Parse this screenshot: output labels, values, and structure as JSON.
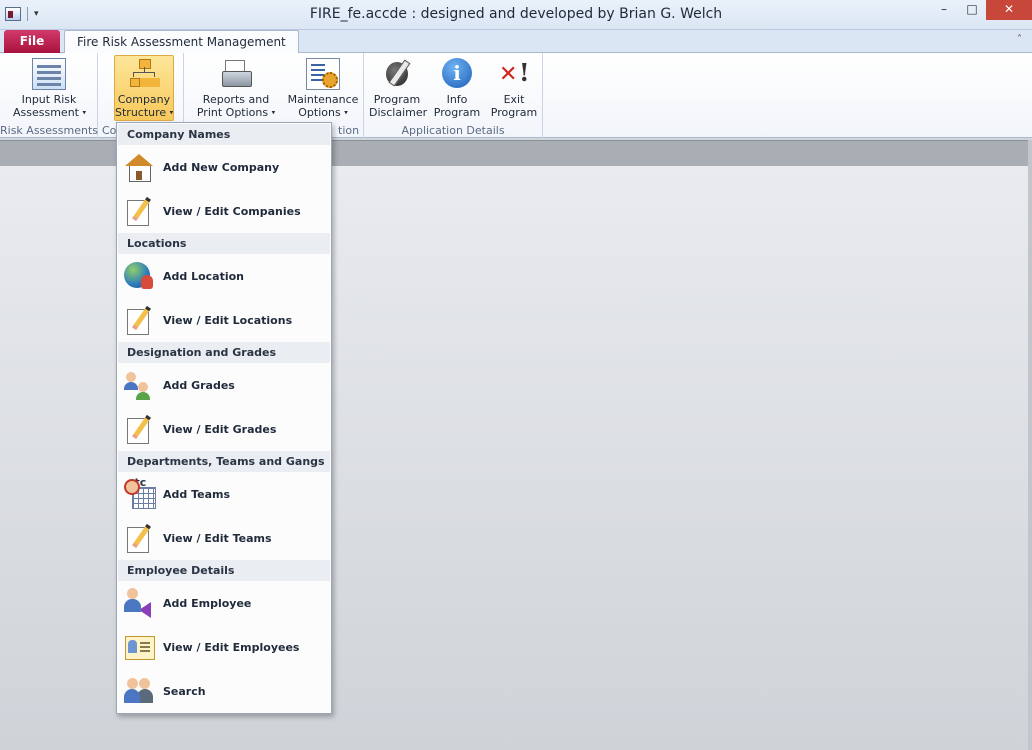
{
  "window": {
    "title": "FIRE_fe.accde : designed and developed by Brian G. Welch",
    "minimize": "–",
    "maximize": "□",
    "close": "✕"
  },
  "tabs": {
    "file": "File",
    "active": "Fire Risk Assessment Management",
    "minimize_ribbon": "˄"
  },
  "ribbon": {
    "groups": [
      {
        "label": "Risk Assessments"
      },
      {
        "label": "Co"
      },
      {
        "label": "tion"
      },
      {
        "label": "Application Details"
      }
    ],
    "buttons": [
      {
        "line1": "Input Risk",
        "line2": "Assessment",
        "icon": "form-icon",
        "dropdown": true
      },
      {
        "line1": "Company",
        "line2": "Structure",
        "icon": "org-chart-icon",
        "dropdown": true,
        "active": true
      },
      {
        "line1": "Reports and",
        "line2": "Print Options",
        "icon": "printer-icon",
        "dropdown": true
      },
      {
        "line1": "Maintenance",
        "line2": "Options",
        "icon": "maintenance-icon",
        "dropdown": true
      },
      {
        "line1": "Program",
        "line2": "Disclaimer",
        "icon": "pen-icon"
      },
      {
        "line1": "Info",
        "line2": "Program",
        "icon": "info-icon"
      },
      {
        "line1": "Exit",
        "line2": "Program",
        "icon": "exit-icon"
      }
    ],
    "caret": "▾"
  },
  "menu": {
    "sections": [
      {
        "title": "Company Names",
        "items": [
          {
            "label": "Add New Company",
            "icon": "house-icon"
          },
          {
            "label": "View / Edit Companies",
            "icon": "edit-icon"
          }
        ]
      },
      {
        "title": "Locations",
        "items": [
          {
            "label": "Add Location",
            "icon": "globe-user-icon"
          },
          {
            "label": "View / Edit Locations",
            "icon": "edit-icon"
          }
        ]
      },
      {
        "title": "Designation and Grades",
        "items": [
          {
            "label": "Add Grades",
            "icon": "people-icon"
          },
          {
            "label": "View / Edit Grades",
            "icon": "edit-icon"
          }
        ]
      },
      {
        "title": "Departments, Teams and Gangs etc",
        "items": [
          {
            "label": "Add Teams",
            "icon": "calendar-team-icon"
          },
          {
            "label": "View / Edit Teams",
            "icon": "edit-icon"
          }
        ]
      },
      {
        "title": "Employee Details",
        "items": [
          {
            "label": "Add Employee",
            "icon": "add-employee-icon"
          },
          {
            "label": "View / Edit Employees",
            "icon": "id-card-icon"
          },
          {
            "label": "Search",
            "icon": "search-people-icon"
          }
        ]
      }
    ]
  },
  "colors": {
    "file_tab": "#c8245a",
    "active_button": "#f8c85a",
    "close_button": "#c7473a"
  }
}
